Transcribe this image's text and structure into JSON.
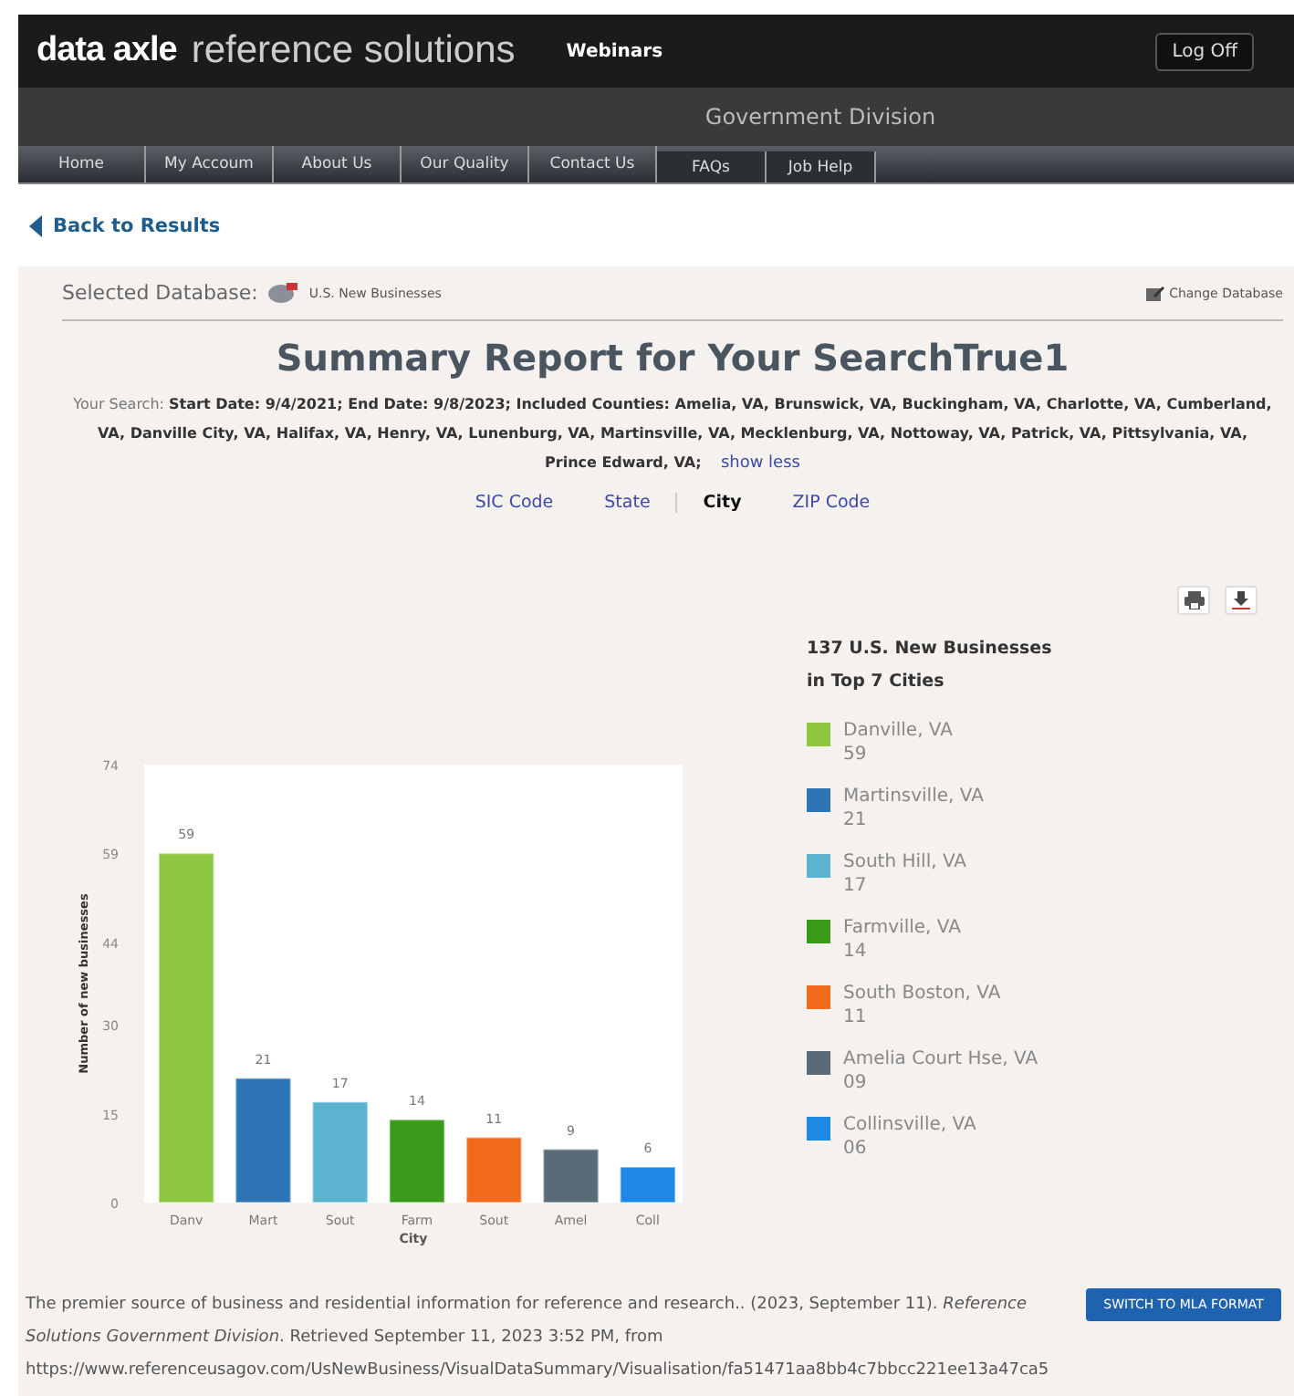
{
  "header": {
    "logo": "data axle",
    "product": "reference solutions",
    "link": "Webinars",
    "logoff": "Log Off"
  },
  "division": "Government Division",
  "nav": [
    {
      "label": "Home"
    },
    {
      "label": "My Accoum"
    },
    {
      "label": "About Us"
    },
    {
      "label": "Our Quality"
    },
    {
      "label": "Contact Us"
    },
    {
      "label": "FAQs"
    },
    {
      "label": "Job Help"
    }
  ],
  "back": "Back to Results",
  "database": {
    "label": "Selected Database:",
    "name": "U.S. New Businesses",
    "change": "Change Database"
  },
  "title": "Summary Report for Your SearchTrue1",
  "search": {
    "label": "Your Search:",
    "text": "Start Date: 9/4/2021; End Date: 9/8/2023; Included Counties: Amelia, VA, Brunswick, VA, Buckingham, VA, Charlotte, VA, Cumberland, VA, Danville City, VA, Halifax, VA, Henry, VA, Lunenburg, VA, Martinsville, VA, Mecklenburg, VA, Nottoway, VA, Patrick, VA, Pittsylvania, VA, Prince Edward, VA;",
    "toggle": "show less"
  },
  "views": [
    {
      "label": "SIC Code",
      "selected": false
    },
    {
      "label": "State",
      "selected": false
    },
    {
      "label": "City",
      "selected": true
    },
    {
      "label": "ZIP Code",
      "selected": false
    }
  ],
  "legend": {
    "title": "137 U.S. New Businesses",
    "subtitle": "in Top 7 Cities",
    "items": [
      {
        "name": "Danville, VA",
        "count": "59",
        "color": "#8dc63f"
      },
      {
        "name": "Martinsville, VA",
        "count": "21",
        "color": "#2e75b6"
      },
      {
        "name": "South Hill, VA",
        "count": "17",
        "color": "#5bb3d0"
      },
      {
        "name": "Farmville, VA",
        "count": "14",
        "color": "#3a9a1a"
      },
      {
        "name": "South Boston, VA",
        "count": "11",
        "color": "#f26b1d"
      },
      {
        "name": "Amelia Court Hse, VA",
        "count": "09",
        "color": "#5a6b78"
      },
      {
        "name": "Collinsville, VA",
        "count": "06",
        "color": "#1e88e5"
      }
    ]
  },
  "chart_data": {
    "type": "bar",
    "xlabel": "City",
    "ylabel": "Number of new businesses",
    "categories": [
      "Danv",
      "Mart",
      "Sout",
      "Farm",
      "Sout",
      "Amel",
      "Coll"
    ],
    "values": [
      59,
      21,
      17,
      14,
      11,
      9,
      6
    ],
    "ylim": [
      0,
      74
    ],
    "yticks": [
      0,
      15,
      30,
      44,
      59,
      74
    ],
    "data_labels": true
  },
  "citation": "The premier source of business and residential information for reference and research.. (2023, September 11). *Reference Solutions Government Division*. Retrieved September 11, 2023 3:52 PM, from https://www.referenceusagov.com/UsNewBusiness/VisualDataSummary/Visualisation/fa51471aa8bb4c7bbcc221ee13a47ca5",
  "mla_button": "SWITCH TO MLA FORMAT"
}
